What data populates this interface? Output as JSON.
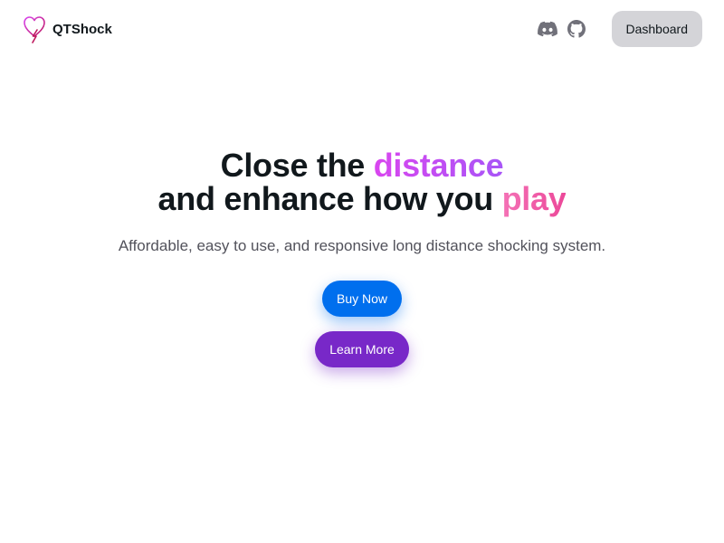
{
  "navbar": {
    "brand": {
      "name": "QTShock",
      "logo_icon": "heart-lightning-icon"
    },
    "icons": [
      {
        "name": "discord-icon",
        "color": "#71717a"
      },
      {
        "name": "github-icon",
        "color": "#71717a"
      }
    ],
    "dashboard_label": "Dashboard"
  },
  "hero": {
    "headline": {
      "line1_prefix": "Close the ",
      "line1_highlight": "distance",
      "line2_prefix": "and enhance how you ",
      "line2_highlight": "play"
    },
    "subtitle": "Affordable, easy to use, and responsive long distance shocking system.",
    "buy_label": "Buy Now",
    "learn_label": "Learn More"
  },
  "colors": {
    "primary": "#006fee",
    "secondary": "#7828c8",
    "highlight_violet": "#c84ef7",
    "highlight_pink": "#f05aa8",
    "dashboard_bg": "#d4d4d8",
    "text": "#11181c",
    "muted_text": "#52525b"
  }
}
